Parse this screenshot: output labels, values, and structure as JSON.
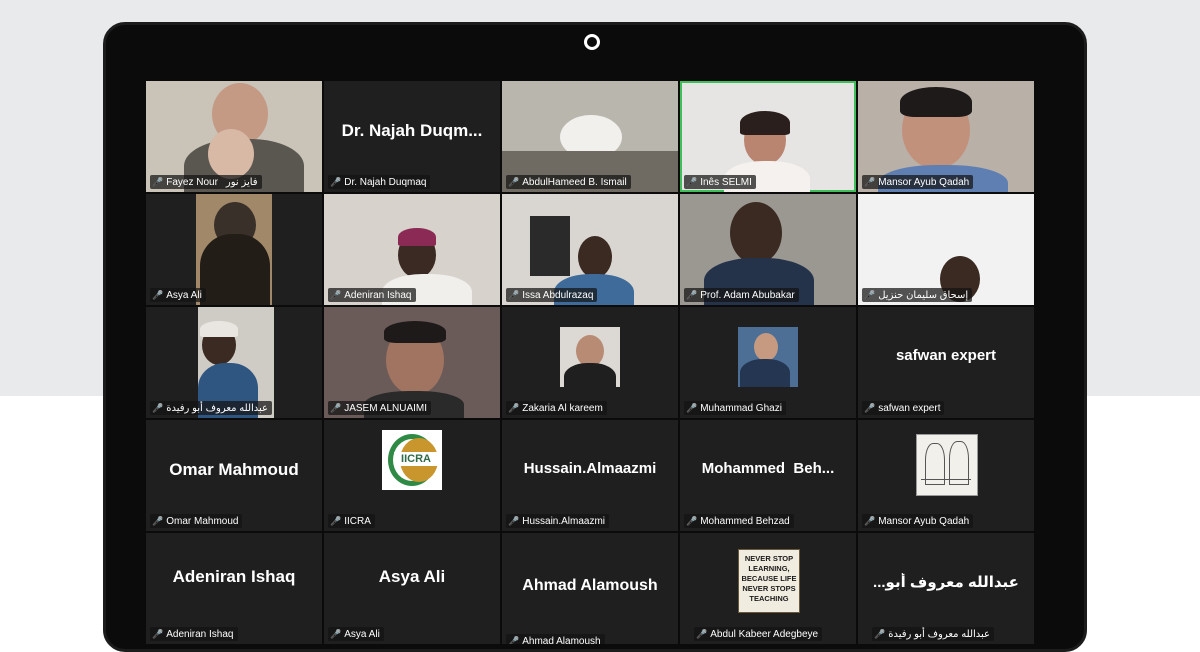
{
  "participants": [
    {
      "name": "Fayez Nour",
      "extra": "فايز نور",
      "type": "video"
    },
    {
      "name": "Dr. Najah Duqmaq",
      "display": "Dr. Najah Duqm...",
      "type": "name"
    },
    {
      "name": "AbdulHameed B. Ismail",
      "type": "video"
    },
    {
      "name": "Inês SELMI",
      "type": "video",
      "active": true
    },
    {
      "name": "Mansor Ayub Qadah",
      "type": "video"
    },
    {
      "name": "Asya Ali",
      "type": "video"
    },
    {
      "name": "Adeniran Ishaq",
      "type": "video"
    },
    {
      "name": "Issa Abdulrazaq",
      "type": "video"
    },
    {
      "name": "Prof. Adam Abubakar",
      "type": "video"
    },
    {
      "name": "إسحاق سليمان حنزيل",
      "type": "video"
    },
    {
      "name": "عبدالله معروف أبو رفيدة",
      "type": "video"
    },
    {
      "name": "JASEM ALNUAIMI",
      "type": "video"
    },
    {
      "name": "Zakaria Al kareem",
      "type": "avatar"
    },
    {
      "name": "Muhammad Ghazi",
      "type": "avatar"
    },
    {
      "name": "safwan expert",
      "display": "safwan expert",
      "type": "name"
    },
    {
      "name": "Omar Mahmoud",
      "display": "Omar Mahmoud",
      "type": "name"
    },
    {
      "name": "IICRA",
      "logo_text": "IICRA",
      "type": "logo"
    },
    {
      "name": "Hussain.Almaazmi",
      "display": "Hussain.Almaazmi",
      "type": "name"
    },
    {
      "name": "Mohammed Behzad",
      "display": "Mohammed  Beh...",
      "type": "name"
    },
    {
      "name": "Mansor Ayub Qadah",
      "type": "sketch"
    },
    {
      "name": "Adeniran Ishaq",
      "display": "Adeniran Ishaq",
      "type": "name"
    },
    {
      "name": "Asya Ali",
      "display": "Asya Ali",
      "type": "name"
    },
    {
      "name": "Ahmad Alamoush",
      "display": "Ahmad Alamoush",
      "type": "name"
    },
    {
      "name": "Abdul Kabeer Adegbeye",
      "sign_text": "NEVER STOP LEARNING, BECAUSE LIFE NEVER STOPS TEACHING",
      "type": "sign"
    },
    {
      "name": "عبدالله معروف أبو رفيدة",
      "display": "عبدالله معروف أبو...",
      "type": "name"
    }
  ],
  "colors": {
    "active_border": "#3fbf5a",
    "mic_muted": "#e03b3b",
    "tile_bg": "#1f1f1f"
  }
}
